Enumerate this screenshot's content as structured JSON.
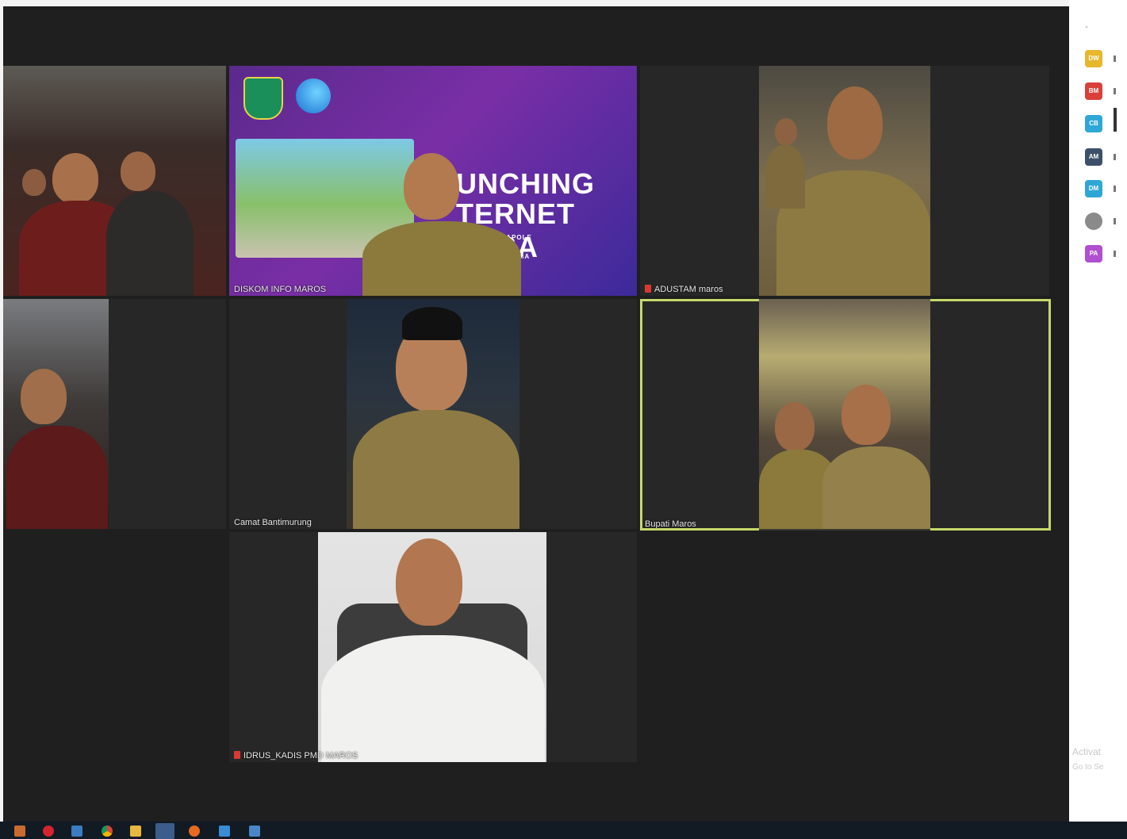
{
  "meeting": {
    "participants": [
      {
        "name": ""
      },
      {
        "name": "DISKOM INFO MAROS"
      },
      {
        "name": "ADUSTAM maros",
        "muted": true
      },
      {
        "name": ""
      },
      {
        "name": "Camat Bantimurung"
      },
      {
        "name": "Bupati Maros",
        "active_speaker": true
      },
      {
        "name": "IDRUS_KADIS PMD MAROS",
        "muted": true
      }
    ],
    "shared_slide": {
      "title_line1": "UNCHING",
      "title_line2": "TERNET DESA",
      "subtitle_line1": "ERAMPAPOLE",
      "subtitle_line2": "LAMA"
    }
  },
  "sidebar": {
    "collapse_label": "-",
    "avatars": [
      {
        "initials": "DW",
        "color": "#e7b72c"
      },
      {
        "initials": "BM",
        "color": "#d9403b"
      },
      {
        "initials": "CB",
        "color": "#2fa7d6"
      },
      {
        "initials": "AM",
        "color": "#3e5069"
      },
      {
        "initials": "DM",
        "color": "#2fa7d6"
      },
      {
        "initials": "",
        "color": "#8a8a8a"
      },
      {
        "initials": "PA",
        "color": "#b04fcf"
      }
    ],
    "activate_line1": "Activat",
    "activate_line2": "Go to Se"
  },
  "taskbar": {
    "icons": [
      "app-icon",
      "opera-icon",
      "calculator-icon",
      "chrome-icon",
      "folder-icon",
      "zoom-icon",
      "firefox-icon",
      "network-icon",
      "device-icon"
    ]
  }
}
